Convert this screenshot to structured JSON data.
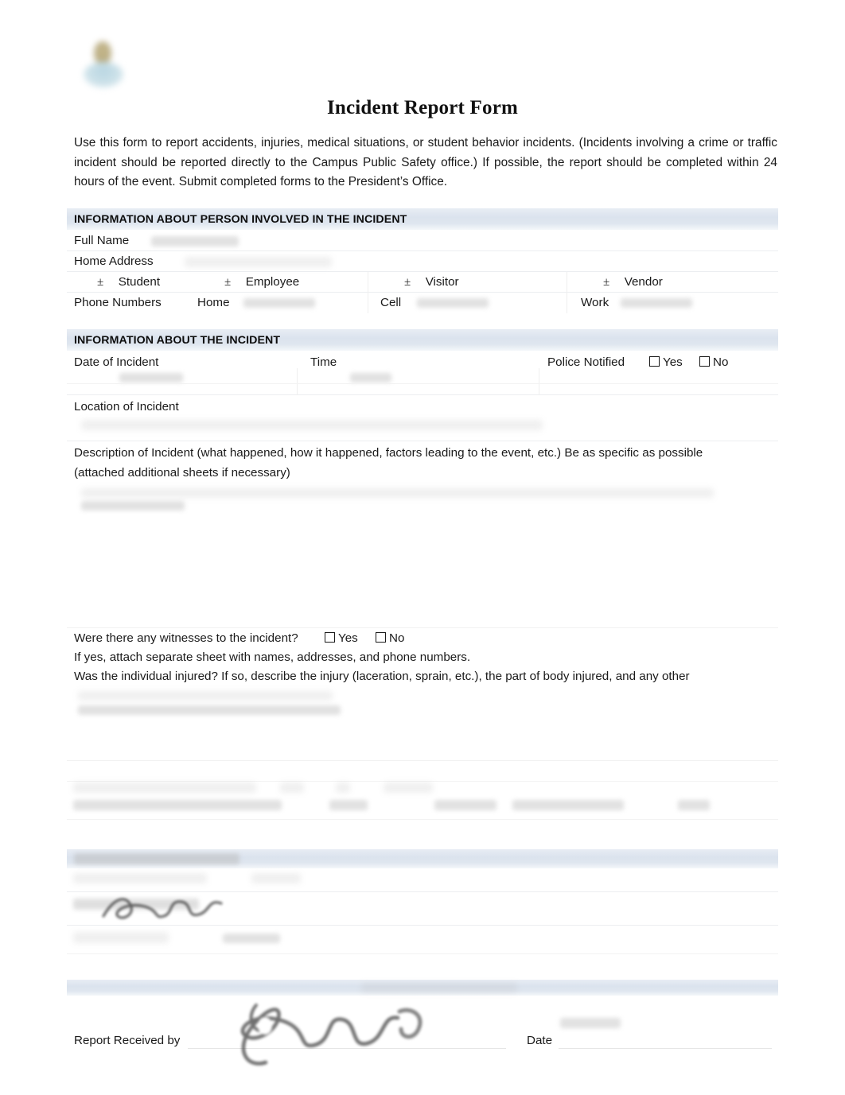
{
  "document": {
    "title": "Incident Report Form",
    "logo_alt": "institution-seal-logo",
    "intro": "Use this form to report accidents, injuries, medical situations, or student behavior incidents. (Incidents involving a crime or traffic incident should be reported directly to the Campus Public Safety office.) If possible, the report should be completed within 24 hours of the event. Submit completed forms to the President’s Office."
  },
  "section_person": {
    "heading": "INFORMATION ABOUT PERSON INVOLVED IN THE INCIDENT",
    "full_name_label": "Full Name",
    "full_name_value": "",
    "home_address_label": "Home Address",
    "home_address_value": "",
    "types": [
      {
        "mark": "±",
        "label": "Student"
      },
      {
        "mark": "±",
        "label": "Employee"
      },
      {
        "mark": "±",
        "label": "Visitor"
      },
      {
        "mark": "±",
        "label": "Vendor"
      }
    ],
    "phone_label": "Phone Numbers",
    "phones": [
      {
        "label": "Home",
        "value": ""
      },
      {
        "label": "Cell",
        "value": ""
      },
      {
        "label": "Work",
        "value": ""
      }
    ]
  },
  "section_incident": {
    "heading": "INFORMATION ABOUT THE INCIDENT",
    "date_label": "Date of Incident",
    "date_value": "",
    "time_label": "Time",
    "time_value": "",
    "police_label": "Police Notified",
    "police_yes": "Yes",
    "police_no": "No",
    "location_label": "Location of Incident",
    "location_value": "",
    "description_label": "Description of Incident (what happened, how it happened, factors leading to the event, etc.) Be as specific as possible (attached additional sheets if necessary)",
    "description_value": "",
    "witness_question": "Were there any witnesses to the incident?",
    "witness_yes": "Yes",
    "witness_no": "No",
    "witness_note": "If yes, attach separate sheet with names, addresses, and phone numbers.",
    "injury_question": "Was the individual injured? If so, describe the injury (laceration, sprain, etc.), the part of body injured, and any other",
    "injury_value": ""
  },
  "section_redacted": {
    "heading": "",
    "note": "",
    "lines": [
      "",
      "",
      ""
    ]
  },
  "section_additional": {
    "heading": "",
    "name_label": "",
    "name_value": "",
    "signature_label": "",
    "signature_value": "",
    "date_label": "",
    "date_value": ""
  },
  "footer": {
    "band_text": "",
    "received_by_label": "Report Received by",
    "received_by_value": "",
    "date_label": "Date",
    "date_value": ""
  },
  "colors": {
    "band": "#dbe3ee",
    "band_light": "#f4f7fa",
    "rule": "#eceef1",
    "text": "#1a1a1a"
  }
}
